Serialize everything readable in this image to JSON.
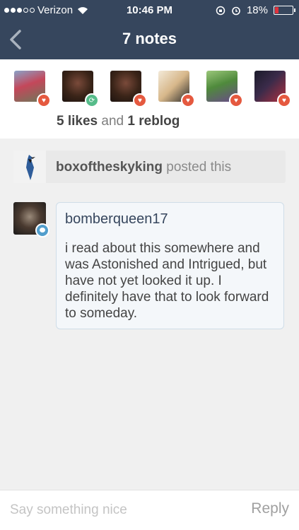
{
  "status_bar": {
    "carrier": "Verizon",
    "time": "10:46 PM",
    "battery": "18%",
    "signal_bars": 3,
    "battery_level": 0.18
  },
  "nav": {
    "title": "7 notes",
    "back_icon": "chevron-left-icon"
  },
  "notes_summary": {
    "likes_count": "5",
    "likes_label": "likes",
    "and": "and",
    "reblog_count": "1",
    "reblog_label": "reblog"
  },
  "avatars": [
    {
      "type": "like",
      "badge_icon": "heart-icon"
    },
    {
      "type": "reblog",
      "badge_icon": "reblog-icon"
    },
    {
      "type": "like",
      "badge_icon": "heart-icon"
    },
    {
      "type": "like",
      "badge_icon": "heart-icon"
    },
    {
      "type": "like",
      "badge_icon": "heart-icon"
    },
    {
      "type": "like",
      "badge_icon": "heart-icon"
    }
  ],
  "posted": {
    "username": "boxoftheskyking",
    "action": "posted this"
  },
  "reply": {
    "username": "bomberqueen17",
    "text": "i read about this somewhere and was Astonished and Intrigued, but have not yet looked it up. I definitely have that to look forward to someday."
  },
  "footer": {
    "placeholder": "Say something nice",
    "reply_label": "Reply"
  },
  "colors": {
    "header_bg": "#36465d",
    "like_badge": "#e5593f",
    "reblog_badge": "#56bc8a",
    "reply_badge": "#529ecc"
  }
}
